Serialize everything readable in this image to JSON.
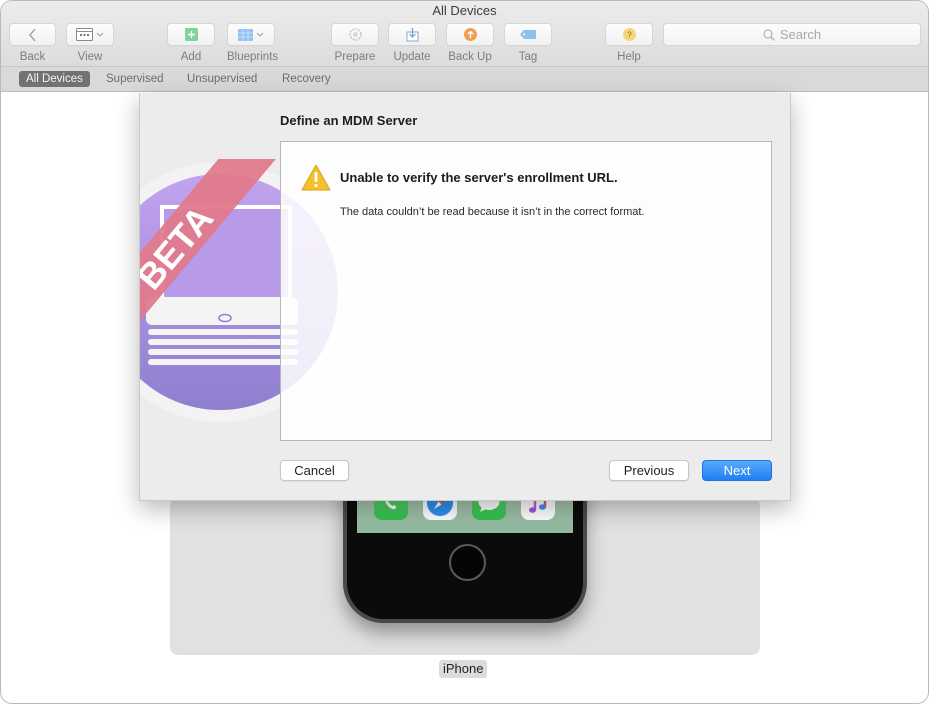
{
  "window": {
    "title": "All Devices"
  },
  "toolbar": {
    "back": "Back",
    "view": "View",
    "add": "Add",
    "blueprints": "Blueprints",
    "prepare": "Prepare",
    "update": "Update",
    "back_up": "Back Up",
    "tag": "Tag",
    "help": "Help",
    "search_placeholder": "Search"
  },
  "filters": [
    {
      "label": "All Devices",
      "active": true
    },
    {
      "label": "Supervised",
      "active": false
    },
    {
      "label": "Unsupervised",
      "active": false
    },
    {
      "label": "Recovery",
      "active": false
    }
  ],
  "sheet": {
    "badge": "BETA",
    "title": "Define an MDM Server",
    "error_title": "Unable to verify the server's enrollment URL.",
    "error_message": "The data couldn’t be read because it isn’t in the correct format.",
    "cancel": "Cancel",
    "previous": "Previous",
    "next": "Next"
  },
  "device": {
    "name": "iPhone",
    "dock_apps": [
      "phone-icon",
      "safari-icon",
      "messages-icon",
      "music-icon"
    ]
  },
  "colors": {
    "accent": "#1f7ff2",
    "badge": "#e07a8c",
    "app_icon_purple": "#a98fe0",
    "warning": "#f3c12c"
  }
}
